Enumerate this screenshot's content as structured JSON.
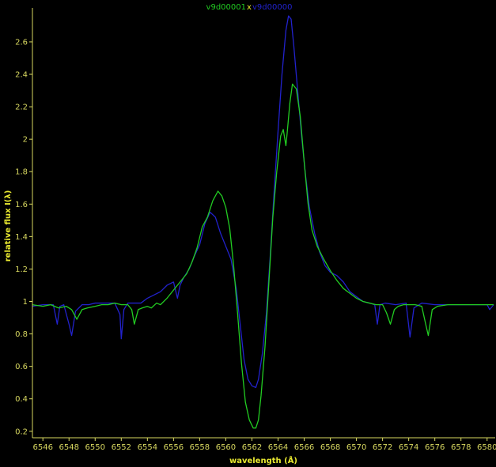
{
  "chart_data": {
    "type": "line",
    "title": "",
    "legend": {
      "placement": "top-center",
      "separator": "x",
      "entries": [
        "v9d00001",
        "v9d00000"
      ]
    },
    "xlabel": "wavelength (Å)",
    "ylabel": "relative flux I(λ)",
    "xlim": [
      6545.2,
      6580.5
    ],
    "ylim": [
      0.16,
      2.78
    ],
    "xticks": [
      6546,
      6548,
      6550,
      6552,
      6554,
      6556,
      6558,
      6560,
      6562,
      6564,
      6566,
      6568,
      6570,
      6572,
      6574,
      6576,
      6578,
      6580
    ],
    "yticks": [
      0.2,
      0.4,
      0.6,
      0.8,
      1,
      1.2,
      1.4,
      1.6,
      1.8,
      2,
      2.2,
      2.4,
      2.6
    ],
    "ytick_labels": [
      "0.2",
      "0.4",
      "0.6",
      "0.8",
      "1",
      "1.2",
      "1.4",
      "1.6",
      "1.8",
      "2",
      "2.2",
      "2.4",
      "2.6"
    ],
    "grid": false,
    "colors": {
      "axis": "#d8d860",
      "label": "#e8e830",
      "background": "#000000"
    },
    "series": [
      {
        "name": "v9d00001",
        "color": "#22cc22",
        "x": [
          6545.2,
          6546.0,
          6546.6,
          6547.2,
          6547.8,
          6548.2,
          6548.6,
          6549.0,
          6549.4,
          6550.0,
          6550.5,
          6551.0,
          6551.5,
          6552.0,
          6552.5,
          6552.8,
          6553.0,
          6553.3,
          6553.6,
          6554.0,
          6554.3,
          6554.7,
          6555.0,
          6555.5,
          6556.0,
          6556.5,
          6557.0,
          6557.4,
          6557.8,
          6558.2,
          6558.6,
          6559.0,
          6559.4,
          6559.7,
          6560.0,
          6560.3,
          6560.6,
          6560.9,
          6561.2,
          6561.5,
          6561.8,
          6562.1,
          6562.3,
          6562.5,
          6562.7,
          6563.0,
          6563.3,
          6563.6,
          6563.9,
          6564.2,
          6564.4,
          6564.6,
          6564.7,
          6564.9,
          6565.1,
          6565.4,
          6565.7,
          6566.0,
          6566.3,
          6566.6,
          6567.0,
          6567.5,
          6568.0,
          6568.5,
          6569.0,
          6569.5,
          6570.0,
          6570.5,
          6571.0,
          6571.5,
          6572.0,
          6572.3,
          6572.6,
          6572.9,
          6573.2,
          6573.6,
          6574.0,
          6574.5,
          6575.0,
          6575.3,
          6575.5,
          6575.8,
          6576.2,
          6577.0,
          6578.0,
          6579.0,
          6580.0,
          6580.5
        ],
        "y": [
          0.98,
          0.97,
          0.98,
          0.96,
          0.97,
          0.95,
          0.89,
          0.95,
          0.96,
          0.97,
          0.98,
          0.98,
          0.99,
          0.98,
          0.98,
          0.95,
          0.86,
          0.95,
          0.96,
          0.97,
          0.96,
          0.99,
          0.98,
          1.02,
          1.07,
          1.12,
          1.17,
          1.24,
          1.33,
          1.46,
          1.52,
          1.62,
          1.68,
          1.65,
          1.58,
          1.45,
          1.22,
          0.93,
          0.62,
          0.38,
          0.27,
          0.22,
          0.22,
          0.27,
          0.42,
          0.72,
          1.12,
          1.52,
          1.8,
          2.02,
          2.06,
          1.96,
          2.04,
          2.22,
          2.34,
          2.31,
          2.14,
          1.86,
          1.6,
          1.44,
          1.34,
          1.26,
          1.19,
          1.13,
          1.08,
          1.05,
          1.02,
          1.0,
          0.99,
          0.98,
          0.98,
          0.93,
          0.86,
          0.95,
          0.97,
          0.98,
          0.98,
          0.98,
          0.97,
          0.86,
          0.79,
          0.95,
          0.97,
          0.98,
          0.98,
          0.98,
          0.98,
          0.98
        ]
      },
      {
        "name": "v9d00000",
        "color": "#2222cc",
        "x": [
          6545.2,
          6546.0,
          6546.8,
          6547.1,
          6547.3,
          6547.6,
          6548.0,
          6548.2,
          6548.5,
          6549.0,
          6549.5,
          6550.0,
          6550.5,
          6551.0,
          6551.5,
          6551.9,
          6552.0,
          6552.2,
          6552.5,
          6553.0,
          6553.5,
          6554.0,
          6554.5,
          6555.0,
          6555.5,
          6556.0,
          6556.3,
          6556.5,
          6556.8,
          6557.2,
          6557.6,
          6558.0,
          6558.4,
          6558.8,
          6559.2,
          6559.6,
          6560.0,
          6560.4,
          6560.8,
          6561.1,
          6561.4,
          6561.7,
          6562.0,
          6562.3,
          6562.5,
          6562.8,
          6563.1,
          6563.4,
          6563.7,
          6564.0,
          6564.3,
          6564.6,
          6564.8,
          6565.0,
          6565.2,
          6565.5,
          6565.8,
          6566.1,
          6566.4,
          6566.8,
          6567.2,
          6567.6,
          6568.0,
          6568.5,
          6569.0,
          6569.5,
          6570.0,
          6570.5,
          6571.0,
          6571.4,
          6571.6,
          6571.8,
          6572.2,
          6573.0,
          6573.8,
          6574.1,
          6574.4,
          6575.0,
          6576.0,
          6577.0,
          6578.0,
          6579.0,
          6580.0,
          6580.2,
          6580.5
        ],
        "y": [
          0.97,
          0.98,
          0.98,
          0.86,
          0.97,
          0.98,
          0.86,
          0.79,
          0.94,
          0.98,
          0.98,
          0.99,
          0.99,
          0.99,
          0.99,
          0.92,
          0.77,
          0.95,
          0.99,
          0.99,
          0.99,
          1.02,
          1.04,
          1.06,
          1.1,
          1.12,
          1.02,
          1.1,
          1.15,
          1.2,
          1.28,
          1.35,
          1.48,
          1.55,
          1.52,
          1.42,
          1.34,
          1.26,
          1.08,
          0.86,
          0.64,
          0.52,
          0.48,
          0.47,
          0.52,
          0.68,
          0.92,
          1.28,
          1.68,
          2.05,
          2.4,
          2.67,
          2.76,
          2.74,
          2.58,
          2.3,
          2.02,
          1.78,
          1.58,
          1.42,
          1.3,
          1.22,
          1.18,
          1.16,
          1.12,
          1.06,
          1.03,
          1.0,
          0.99,
          0.98,
          0.86,
          0.98,
          0.99,
          0.98,
          0.99,
          0.78,
          0.96,
          0.99,
          0.98,
          0.98,
          0.98,
          0.98,
          0.98,
          0.95,
          0.98
        ]
      }
    ]
  }
}
